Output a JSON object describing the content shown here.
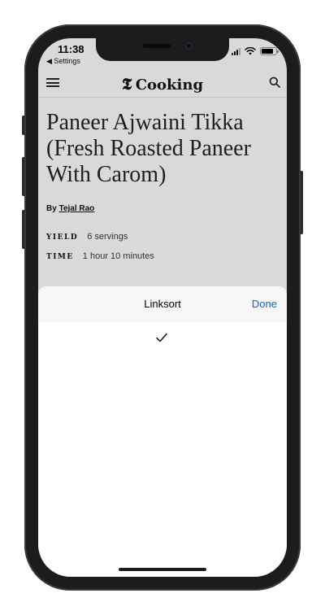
{
  "status_bar": {
    "time": "11:38",
    "back_label": "◀ Settings",
    "signal_bars": 4,
    "signal_bars_active": 3,
    "battery_level": 0.8
  },
  "app_header": {
    "menu_icon": "hamburger-menu-icon",
    "logo_mark": "𝕿",
    "logo_text": "Cooking",
    "search_icon": "search-icon"
  },
  "recipe": {
    "title": "Paneer Ajwaini Tikka (Fresh Roasted Paneer With Carom)",
    "byline_prefix": "By",
    "author": "Tejal Rao",
    "yield_label": "YIELD",
    "yield_value": "6 servings",
    "time_label": "TIME",
    "time_value": "1 hour 10 minutes"
  },
  "sheet": {
    "title": "Linksort",
    "done_label": "Done",
    "check_icon": "checkmark-icon"
  },
  "colors": {
    "accent": "#0a64d6",
    "page_background": "#d9d9d9",
    "sheet_background": "#ffffff",
    "sheet_header_background": "#f7f7f7"
  }
}
